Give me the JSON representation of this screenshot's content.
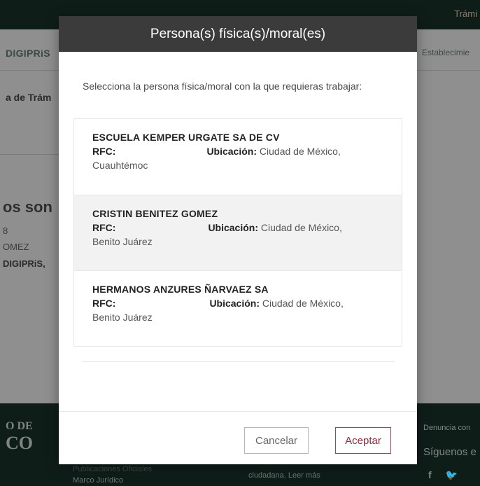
{
  "background": {
    "tramites": "Trámi",
    "brand": "DIGIPRiS",
    "establecimientos": "Establecimie",
    "tramites_section": "a de Trám",
    "heading": "os son",
    "line1": "8",
    "line2": "OMEZ",
    "line3": "DIGIPRiS,",
    "footer_gob_line1": "O DE",
    "footer_gob_line2": "CO",
    "footer_denuncia": "Denuncia con",
    "footer_siguenos": "Síguenos e",
    "footer_social": "f  🐦",
    "footer_publicaciones": "Publicaciones Oficiales",
    "footer_marco": "Marco Jurídico",
    "footer_ciudadana": "ciudadana. Leer más"
  },
  "modal": {
    "title": "Persona(s) física(s)/moral(es)",
    "intro": "Selecciona la persona física/moral con la que requieras trabajar:",
    "rfc_label": "RFC:",
    "location_label": "Ubicación:",
    "persons": [
      {
        "name": "ESCUELA KEMPER URGATE SA DE CV",
        "location": "Ciudad de México,",
        "municipality": "Cuauhtémoc"
      },
      {
        "name": "CRISTIN BENITEZ GOMEZ",
        "location": "Ciudad de México,",
        "municipality": "Benito Juárez"
      },
      {
        "name": "HERMANOS ANZURES ÑARVAEZ SA",
        "location": "Ciudad de México,",
        "municipality": "Benito Juárez"
      }
    ],
    "cancel_label": "Cancelar",
    "accept_label": "Aceptar"
  },
  "colors": {
    "header": "#3c3b3b",
    "accent": "#8c2b3c",
    "overlay": "#8f8f8f",
    "footer": "#0f1d19"
  },
  "icons": {
    "cursor": "hand-pointer-icon"
  }
}
